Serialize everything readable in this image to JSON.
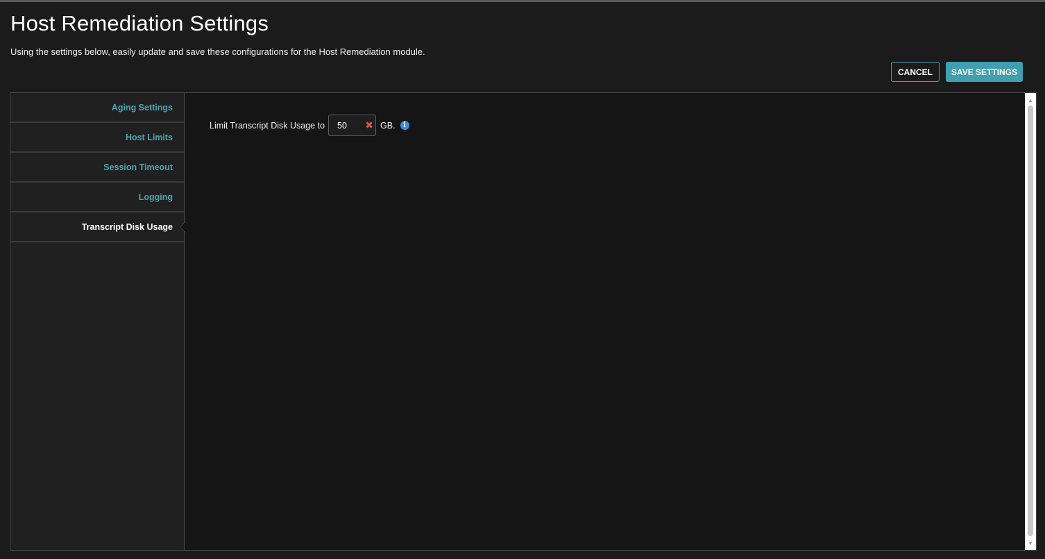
{
  "header": {
    "title": "Host Remediation Settings",
    "subtitle": "Using the settings below, easily update and save these configurations for the Host Remediation module."
  },
  "actions": {
    "cancel_label": "CANCEL",
    "save_label": "SAVE SETTINGS"
  },
  "sidebar": {
    "items": [
      {
        "label": "Aging Settings",
        "active": false
      },
      {
        "label": "Host Limits",
        "active": false
      },
      {
        "label": "Session Timeout",
        "active": false
      },
      {
        "label": "Logging",
        "active": false
      },
      {
        "label": "Transcript Disk Usage",
        "active": true
      }
    ]
  },
  "transcript_disk_usage": {
    "label": "Limit Transcript Disk Usage to",
    "value": "50",
    "unit": "GB.",
    "clear_icon": "clear-x-icon",
    "info_icon": "info-icon"
  },
  "colors": {
    "accent": "#40a0b0",
    "background": "#1b1b1b",
    "clear": "#d9534f",
    "info": "#3b8fd9"
  }
}
